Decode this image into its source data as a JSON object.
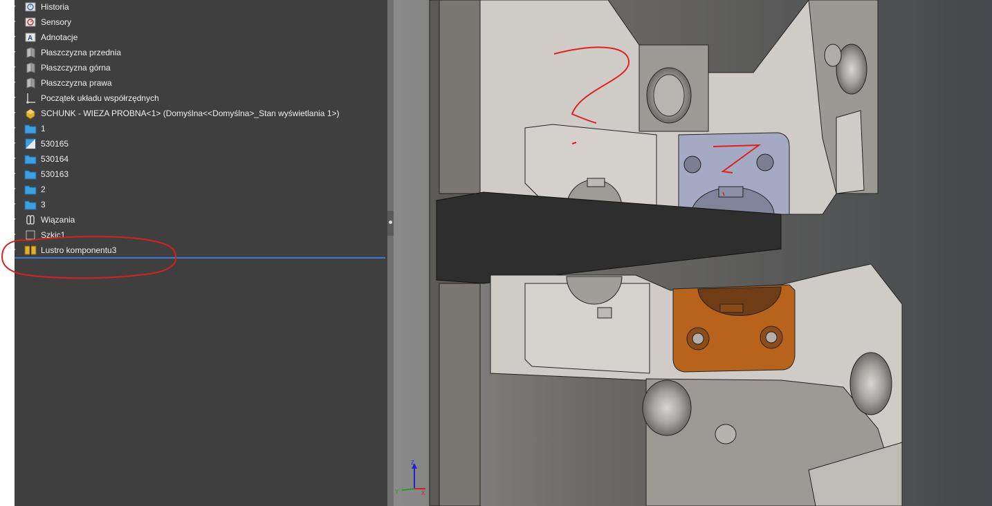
{
  "feature_tree": {
    "items": [
      {
        "label": "Historia",
        "icon": "history-icon"
      },
      {
        "label": "Sensory",
        "icon": "sensors-icon"
      },
      {
        "label": "Adnotacje",
        "icon": "annotations-icon"
      },
      {
        "label": "Płaszczyzna przednia",
        "icon": "plane-icon"
      },
      {
        "label": "Płaszczyzna górna",
        "icon": "plane-icon"
      },
      {
        "label": "Płaszczyzna prawa",
        "icon": "plane-icon"
      },
      {
        "label": "Początek układu współrzędnych",
        "icon": "origin-icon"
      },
      {
        "label": "SCHUNK - WIEZA PROBNA<1> (Domyślna<<Domyślna>_Stan wyświetlania 1>)",
        "icon": "assembly-icon"
      },
      {
        "label": "1",
        "icon": "folder-icon"
      },
      {
        "label": "530165",
        "icon": "part-icon"
      },
      {
        "label": "530164",
        "icon": "folder-icon"
      },
      {
        "label": "530163",
        "icon": "folder-icon"
      },
      {
        "label": "2",
        "icon": "folder-icon"
      },
      {
        "label": "3",
        "icon": "folder-icon"
      },
      {
        "label": "Wiązania",
        "icon": "mates-icon"
      },
      {
        "label": "Szkic1",
        "icon": "sketch-icon"
      },
      {
        "label": "Lustro komponentu3",
        "icon": "mirror-component-icon"
      }
    ]
  },
  "colors": {
    "panel_bg": "#3f3f3f",
    "text": "#f0f0f0",
    "folder": "#3d9ee0",
    "rollback_bar": "#3b7bd6",
    "annotation_red": "#e0201c",
    "part_grey": "#cfccc8",
    "highlight_blue_part": "#a4a9c4",
    "orange_part": "#b8631c"
  },
  "viewport": {
    "triad": {
      "z": "Z",
      "y": "Y",
      "x": "X"
    }
  }
}
